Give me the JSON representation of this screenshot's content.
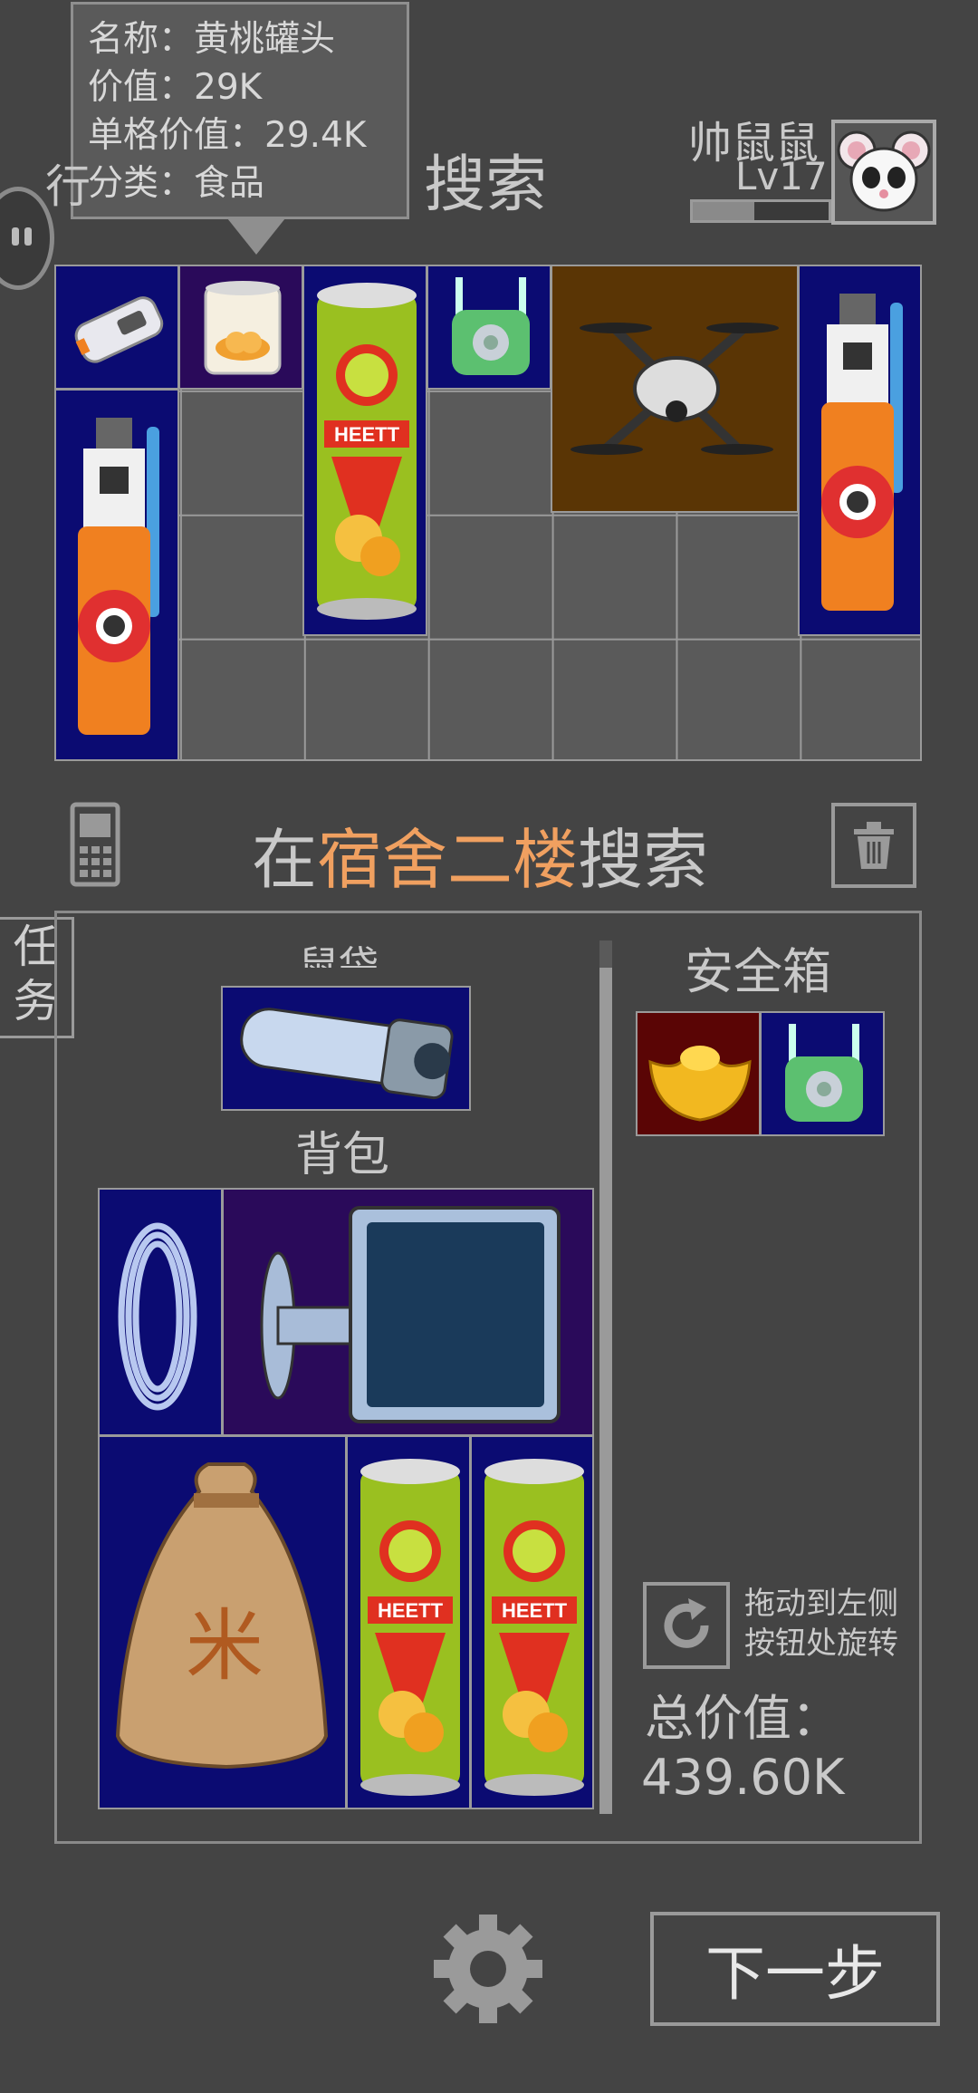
{
  "tooltip": {
    "name": "名称：黄桃罐头",
    "value": "价值：29K",
    "unit_value": "单格价值：29.4K",
    "category": "分类：食品"
  },
  "header": {
    "title_partial_left": "行",
    "title_right": "搜索",
    "username": "帅鼠鼠",
    "level": "Lv17",
    "level_progress": 0.45
  },
  "location": {
    "prefix": "在",
    "place": "宿舍二楼",
    "suffix": "搜索",
    "accent_color": "#f0a060"
  },
  "sidebar": {
    "tasks_label_1": "任",
    "tasks_label_2": "务"
  },
  "equipment": {
    "slot_label_partial": "鼠袋",
    "backpack_label": "背包",
    "safe_label": "安全箱"
  },
  "hint": {
    "line1": "拖动到左侧",
    "line2": "按钮处旋转"
  },
  "total": {
    "label": "总价值：",
    "value": "439.60K"
  },
  "buttons": {
    "next": "下一步"
  },
  "items": {
    "power_bank": "power-bank",
    "peach_can": "peach-can",
    "chips": "chips-can",
    "router": "router",
    "drone": "drone",
    "spray": "spray-bottle",
    "flashlight": "flashlight",
    "cable": "cable-coil",
    "monitor": "monitor",
    "rice_bag": "rice-bag",
    "gold": "gold-ingot"
  }
}
